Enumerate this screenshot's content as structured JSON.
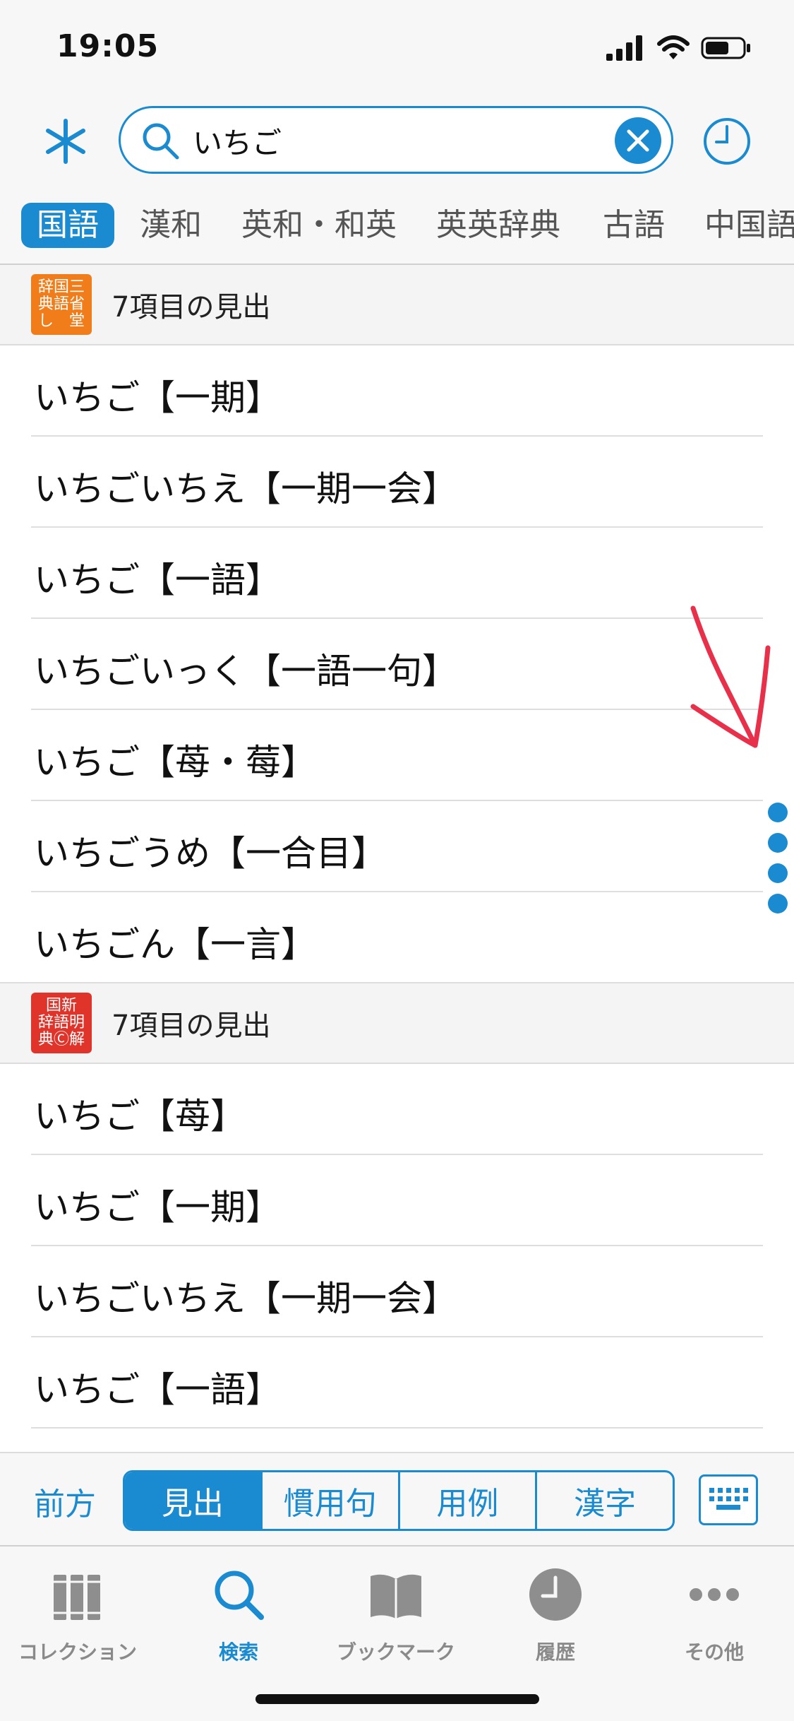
{
  "status_bar": {
    "time": "19:05"
  },
  "search": {
    "query": "いちご"
  },
  "dictionary_tabs": [
    {
      "label": "国語",
      "active": true
    },
    {
      "label": "漢和",
      "active": false
    },
    {
      "label": "英和・和英",
      "active": false
    },
    {
      "label": "英英辞典",
      "active": false
    },
    {
      "label": "古語",
      "active": false
    },
    {
      "label": "中国語",
      "active": false
    }
  ],
  "sections": [
    {
      "book_icon_text": "辞国三\n典語省\nし　堂",
      "book_icon_color": "#f07d1a",
      "count_label": "7項目の見出",
      "entries": [
        "いちご【一期】",
        "いちごいちえ【一期一会】",
        "いちご【一語】",
        "いちごいっく【一語一句】",
        "いちご【苺・莓】",
        "いちごうめ【一合目】",
        "いちごん【一言】"
      ]
    },
    {
      "book_icon_text": "国新\n辞語明\n典Ⓒ解",
      "book_icon_color": "#e0332a",
      "count_label": "7項目の見出",
      "entries": [
        "いちご【苺】",
        "いちご【一期】",
        "いちごいちえ【一期一会】",
        "いちご【一語】"
      ]
    }
  ],
  "search_modes": {
    "prev_label": "前方",
    "segments": [
      {
        "label": "見出",
        "active": true
      },
      {
        "label": "慣用句",
        "active": false
      },
      {
        "label": "用例",
        "active": false
      },
      {
        "label": "漢字",
        "active": false
      }
    ]
  },
  "tab_bar": [
    {
      "label": "コレクション",
      "icon": "books-icon",
      "active": false
    },
    {
      "label": "検索",
      "icon": "search-icon",
      "active": true
    },
    {
      "label": "ブックマーク",
      "icon": "open-book-icon",
      "active": false
    },
    {
      "label": "履歴",
      "icon": "clock-icon",
      "active": false
    },
    {
      "label": "その他",
      "icon": "more-icon",
      "active": false
    }
  ],
  "colors": {
    "accent": "#1a8bd0",
    "annotation": "#e8304a"
  }
}
